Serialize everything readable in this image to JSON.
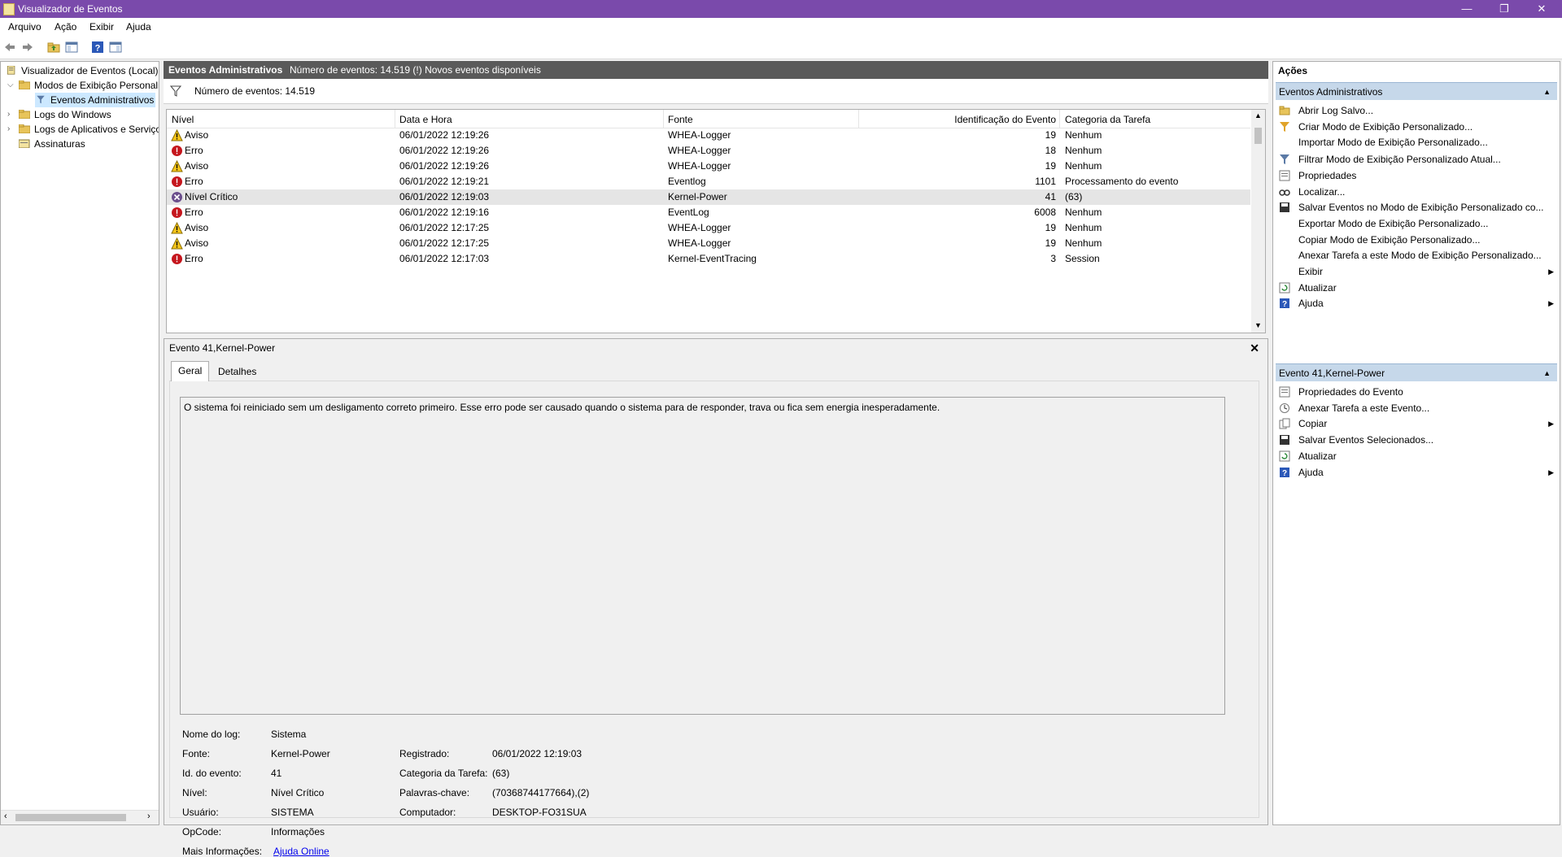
{
  "window": {
    "title": "Visualizador de Eventos",
    "min": "—",
    "restore": "❐",
    "close": "✕"
  },
  "menu": [
    "Arquivo",
    "Ação",
    "Exibir",
    "Ajuda"
  ],
  "tree": {
    "root": "Visualizador de Eventos (Local)",
    "custom_views": "Modos de Exibição Personali",
    "admin_events": "Eventos Administrativos",
    "windows_logs": "Logs do Windows",
    "app_logs": "Logs de Aplicativos e Serviço",
    "subscriptions": "Assinaturas"
  },
  "center": {
    "header_title": "Eventos Administrativos",
    "header_info": "Número de eventos: 14.519 (!) Novos eventos disponíveis",
    "filter_text": "Número de eventos: 14.519",
    "columns": [
      "Nível",
      "Data e Hora",
      "Fonte",
      "Identificação do Evento",
      "Categoria da Tarefa"
    ],
    "rows": [
      {
        "level": "Aviso",
        "type": "warn",
        "date": "06/01/2022 12:19:26",
        "source": "WHEA-Logger",
        "id": "19",
        "cat": "Nenhum"
      },
      {
        "level": "Erro",
        "type": "err",
        "date": "06/01/2022 12:19:26",
        "source": "WHEA-Logger",
        "id": "18",
        "cat": "Nenhum"
      },
      {
        "level": "Aviso",
        "type": "warn",
        "date": "06/01/2022 12:19:26",
        "source": "WHEA-Logger",
        "id": "19",
        "cat": "Nenhum"
      },
      {
        "level": "Erro",
        "type": "err",
        "date": "06/01/2022 12:19:21",
        "source": "Eventlog",
        "id": "1101",
        "cat": "Processamento do evento"
      },
      {
        "level": "Nível Crítico",
        "type": "crit",
        "date": "06/01/2022 12:19:03",
        "source": "Kernel-Power",
        "id": "41",
        "cat": "(63)"
      },
      {
        "level": "Erro",
        "type": "err",
        "date": "06/01/2022 12:19:16",
        "source": "EventLog",
        "id": "6008",
        "cat": "Nenhum"
      },
      {
        "level": "Aviso",
        "type": "warn",
        "date": "06/01/2022 12:17:25",
        "source": "WHEA-Logger",
        "id": "19",
        "cat": "Nenhum"
      },
      {
        "level": "Aviso",
        "type": "warn",
        "date": "06/01/2022 12:17:25",
        "source": "WHEA-Logger",
        "id": "19",
        "cat": "Nenhum"
      },
      {
        "level": "Erro",
        "type": "err",
        "date": "06/01/2022 12:17:03",
        "source": "Kernel-EventTracing",
        "id": "3",
        "cat": "Session"
      }
    ]
  },
  "detail": {
    "title": "Evento 41,Kernel-Power",
    "close": "✕",
    "tabs": [
      "Geral",
      "Detalhes"
    ],
    "description": "O sistema foi reiniciado sem um desligamento correto primeiro. Esse erro pode ser causado quando o sistema para de responder, trava ou fica sem energia inesperadamente.",
    "fields": {
      "log_name_label": "Nome do log:",
      "log_name": "Sistema",
      "source_label": "Fonte:",
      "source": "Kernel-Power",
      "event_id_label": "Id. do evento:",
      "event_id": "41",
      "level_label": "Nível:",
      "level": "Nível Crítico",
      "user_label": "Usuário:",
      "user": "SISTEMA",
      "opcode_label": "OpCode:",
      "opcode": "Informações",
      "more_info_label": "Mais Informações:",
      "more_info": "Ajuda Online",
      "logged_label": "Registrado:",
      "logged": "06/01/2022 12:19:03",
      "task_label": "Categoria da Tarefa:",
      "task": "(63)",
      "keywords_label": "Palavras-chave:",
      "keywords": "(70368744177664),(2)",
      "computer_label": "Computador:",
      "computer": "DESKTOP-FO31SUA"
    }
  },
  "actions": {
    "title": "Ações",
    "section1": "Eventos Administrativos",
    "items1": [
      {
        "label": "Abrir Log Salvo...",
        "icon": "open-folder-icon",
        "sub": false
      },
      {
        "label": "Criar Modo de Exibição Personalizado...",
        "icon": "create-filter-icon",
        "sub": false
      },
      {
        "label": "Importar Modo de Exibição Personalizado...",
        "icon": "none",
        "sub": false
      },
      {
        "label": "Filtrar Modo de Exibição Personalizado Atual...",
        "icon": "filter-icon",
        "sub": false
      },
      {
        "label": "Propriedades",
        "icon": "properties-icon",
        "sub": false
      },
      {
        "label": "Localizar...",
        "icon": "find-icon",
        "sub": false
      },
      {
        "label": "Salvar Eventos no Modo de Exibição Personalizado co...",
        "icon": "save-icon",
        "sub": false
      },
      {
        "label": "Exportar Modo de Exibição Personalizado...",
        "icon": "none",
        "sub": false
      },
      {
        "label": "Copiar Modo de Exibição Personalizado...",
        "icon": "none",
        "sub": false
      },
      {
        "label": "Anexar Tarefa a este Modo de Exibição Personalizado...",
        "icon": "none",
        "sub": false
      },
      {
        "label": "Exibir",
        "icon": "none",
        "sub": true
      },
      {
        "label": "Atualizar",
        "icon": "refresh-icon",
        "sub": false
      },
      {
        "label": "Ajuda",
        "icon": "help-icon",
        "sub": true
      }
    ],
    "section2": "Evento 41,Kernel-Power",
    "items2": [
      {
        "label": "Propriedades do Evento",
        "icon": "properties-icon",
        "sub": false
      },
      {
        "label": "Anexar Tarefa a este Evento...",
        "icon": "task-icon",
        "sub": false
      },
      {
        "label": "Copiar",
        "icon": "copy-icon",
        "sub": true
      },
      {
        "label": "Salvar Eventos Selecionados...",
        "icon": "save-icon",
        "sub": false
      },
      {
        "label": "Atualizar",
        "icon": "refresh-icon",
        "sub": false
      },
      {
        "label": "Ajuda",
        "icon": "help-icon",
        "sub": true
      }
    ]
  },
  "colors": {
    "titlebar": "#7a4aab",
    "header": "#5a5a5a",
    "section": "#c6d8ea",
    "link": "#0000ee"
  }
}
